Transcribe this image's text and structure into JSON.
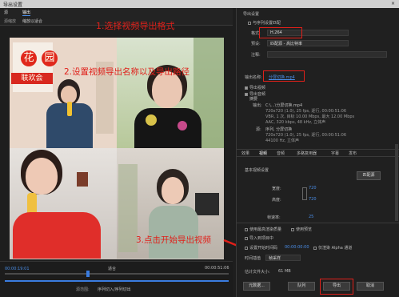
{
  "window": {
    "title": "导出设置",
    "close": "×"
  },
  "left_tabs": {
    "source": "源",
    "output": "输出"
  },
  "left_sub": {
    "scale_label": "源缩放",
    "scale_value": "缩放以适合"
  },
  "annotations": {
    "step1": "1.选择视频导出格式",
    "step2": "2.设置视频导出名称以及导出路径",
    "step3": "3.点击开始导出视频"
  },
  "preview_text": {
    "flower": "花",
    "garden": "园",
    "party": "联欢会"
  },
  "export_settings": {
    "header": "导出设置",
    "match_sequence": "与序列设置匹配",
    "format_label": "格式:",
    "format_value": "H.264",
    "preset_label": "预设:",
    "preset_value": "匹配源 - 高比特率",
    "comment_label": "注释:",
    "output_name_label": "输出名称:",
    "output_name_value": "分屏切换.mp4",
    "export_video": "导出视频",
    "export_audio": "导出音频",
    "summary_label": "摘要",
    "summary_output_label": "输出:",
    "summary_output": "C:\\...\\分屏切换.mp4",
    "summary_output_line2": "720x720 (1.0), 25 fps, 逐行, 00:00:51:06",
    "summary_output_line3": "VBR, 1 次, 目标 10.00 Mbps, 最大 12.00 Mbps",
    "summary_output_line4": "AAC, 320 kbps, 48 kHz, 立体声",
    "summary_source_label": "源:",
    "summary_source": "序列, 分屏切换",
    "summary_source_line2": "720x720 (1.0), 25 fps, 逐行, 00:00:51:06",
    "summary_source_line3": "44100 Hz, 立体声"
  },
  "settings_tabs": [
    "效果",
    "视频",
    "音频",
    "多路复用器",
    "字幕",
    "发布"
  ],
  "basic_video": {
    "header": "基本视频设置",
    "match_source_button": "匹配源",
    "width_label": "宽度:",
    "width_value": "720",
    "height_label": "高度:",
    "height_value": "720",
    "framerate_label": "帧速率:",
    "framerate_value": "25"
  },
  "bottom_options": {
    "max_render": "使用最高渲染质量",
    "use_preview": "使用预览",
    "import_project": "导入到项目中",
    "set_start_timecode": "设置开始时间码",
    "start_timecode_value": "00:00:00:00",
    "render_alpha": "仅渲染 Alpha 通道",
    "time_interpolation_label": "时间插值",
    "time_interpolation_value": "帧采样",
    "file_size_label": "估计文件大小:",
    "file_size_value": "61 MB"
  },
  "buttons": {
    "metadata": "元数据...",
    "queue": "队列",
    "export": "导出",
    "cancel": "取消"
  },
  "timeline": {
    "current_time": "00:00:19:01",
    "end_time": "00:00:51:06",
    "fit_label": "适合",
    "source_range_label": "源范围:",
    "source_range_value": "序列切入/序列切出"
  },
  "colors": {
    "annotation_red": "#e0201a",
    "link_blue": "#4a8ee8",
    "panel_bg": "#202020"
  }
}
